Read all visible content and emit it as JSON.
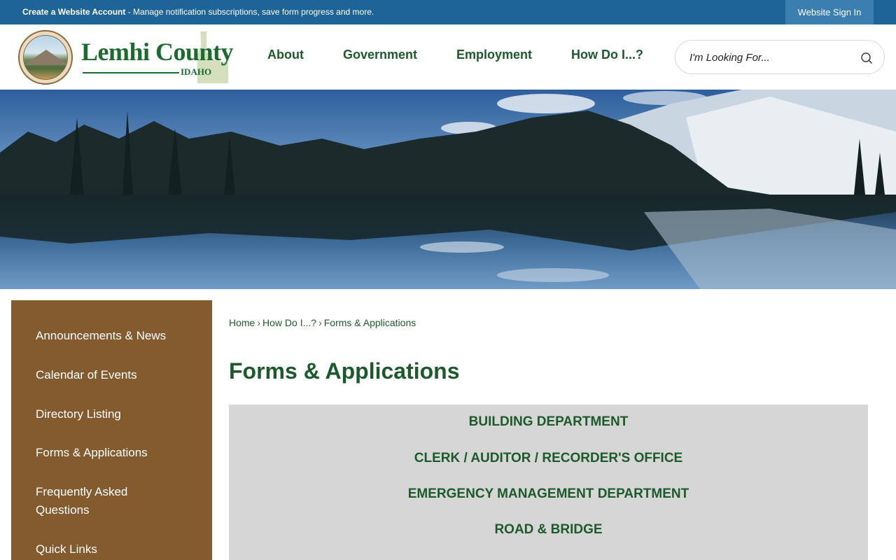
{
  "topbar": {
    "account_link": "Create a Website Account",
    "account_text": " - Manage notification subscriptions, save form progress and more.",
    "signin_label": "Website Sign In"
  },
  "header": {
    "logo_title": "Lemhi County",
    "logo_state": "IDAHO",
    "nav": [
      "About",
      "Government",
      "Employment",
      "How Do I...?"
    ],
    "search_placeholder": "I'm Looking For..."
  },
  "sidebar": {
    "items": [
      "Announcements & News",
      "Calendar of Events",
      "Directory Listing",
      "Forms & Applications",
      "Frequently Asked Questions",
      "Quick Links"
    ]
  },
  "breadcrumb": {
    "items": [
      "Home",
      "How Do I...?",
      "Forms & Applications"
    ],
    "separator": "›"
  },
  "main": {
    "title": "Forms & Applications",
    "departments": [
      "BUILDING DEPARTMENT",
      "CLERK / AUDITOR / RECORDER'S OFFICE",
      "EMERGENCY MANAGEMENT DEPARTMENT",
      "ROAD & BRIDGE"
    ]
  },
  "colors": {
    "topbar": "#1f6496",
    "brand_green": "#1c5a2b",
    "sidebar_brown": "#845b2e",
    "panel_gray": "#d6d6d6"
  },
  "icons": {
    "search": "search-icon",
    "seal": "county-seal-icon"
  }
}
